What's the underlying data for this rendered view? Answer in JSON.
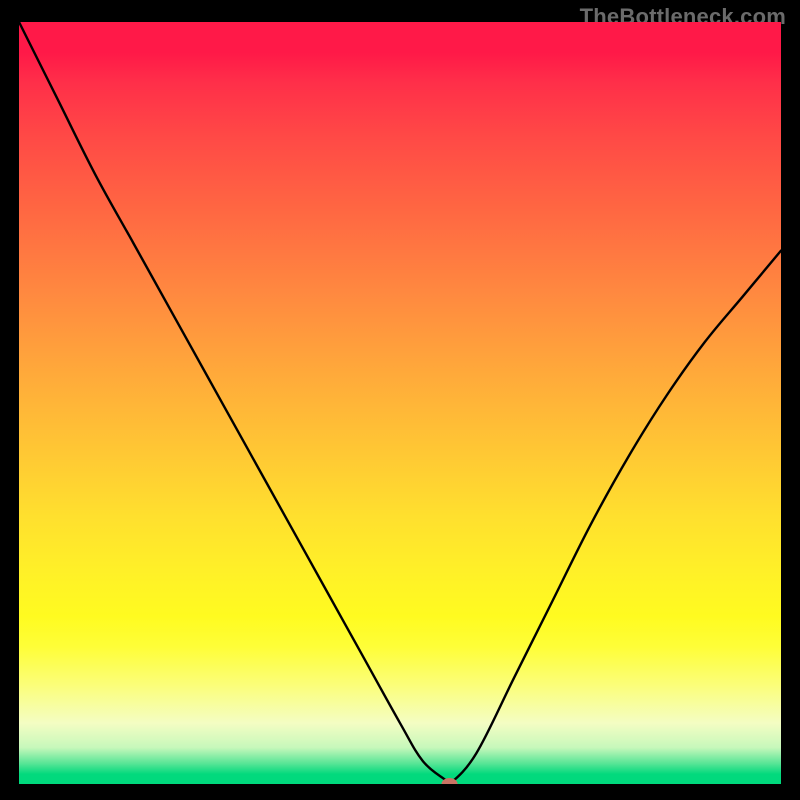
{
  "watermark": "TheBottleneck.com",
  "chart_data": {
    "type": "line",
    "title": "",
    "xlabel": "",
    "ylabel": "",
    "xlim": [
      0,
      1
    ],
    "ylim": [
      0,
      1
    ],
    "axis_ticks_visible": false,
    "grid": false,
    "legend": false,
    "background": "rainbow-vertical-gradient",
    "gradient_note": "green (bottom, 0%) → yellow → orange → red (top, 100%)",
    "series": [
      {
        "name": "bottleneck-curve",
        "color": "#000000",
        "x": [
          0.0,
          0.05,
          0.1,
          0.15,
          0.2,
          0.25,
          0.3,
          0.35,
          0.4,
          0.45,
          0.5,
          0.53,
          0.56,
          0.565,
          0.6,
          0.65,
          0.7,
          0.75,
          0.8,
          0.85,
          0.9,
          0.95,
          1.0
        ],
        "values": [
          1.0,
          0.9,
          0.8,
          0.71,
          0.62,
          0.53,
          0.44,
          0.35,
          0.26,
          0.17,
          0.08,
          0.03,
          0.005,
          0.0,
          0.04,
          0.14,
          0.24,
          0.34,
          0.43,
          0.51,
          0.58,
          0.64,
          0.7
        ]
      }
    ],
    "annotations": [
      {
        "name": "minimum-marker",
        "x": 0.565,
        "y": 0.0,
        "shape": "rounded-dot",
        "color": "#c97364"
      }
    ]
  }
}
